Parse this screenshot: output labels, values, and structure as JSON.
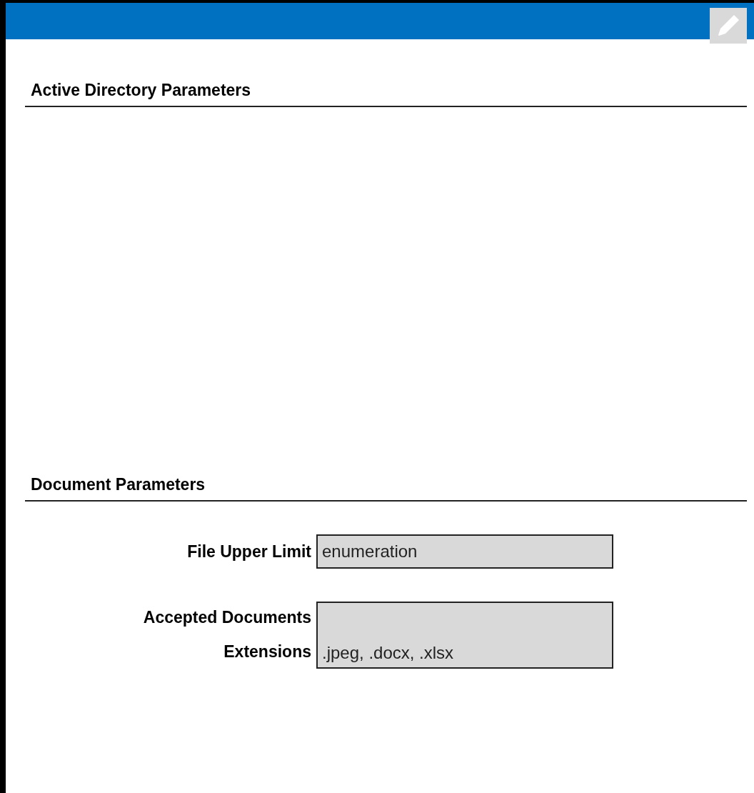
{
  "sections": [
    {
      "title": "Active Directory Parameters"
    },
    {
      "title": "Document Parameters",
      "fields": [
        {
          "kind": "single",
          "label": "File Upper Limit",
          "value": "enumeration"
        },
        {
          "kind": "multi",
          "label": "Accepted Documents Extensions",
          "value": ".jpeg, .docx, .xlsx"
        }
      ]
    }
  ]
}
